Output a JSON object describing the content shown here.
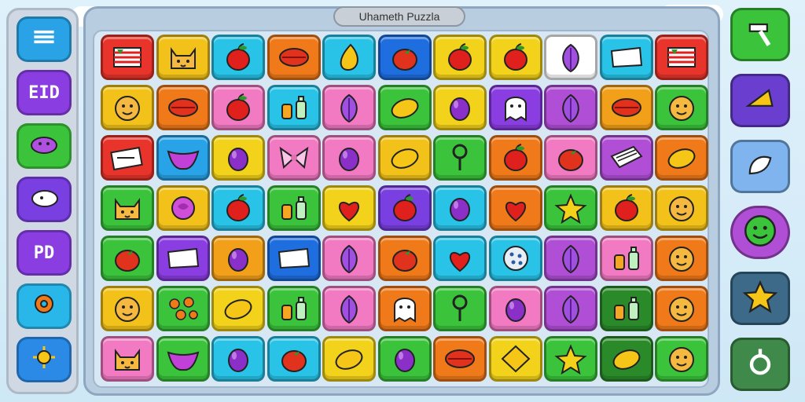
{
  "title": "Uhameth Puzzla",
  "left_panel": {
    "buttons": [
      {
        "id": "menu",
        "icon": "menu-icon",
        "label": "",
        "color": "#2aa3e6"
      },
      {
        "id": "eid",
        "icon": "",
        "label": "EID",
        "color": "#8a3de0"
      },
      {
        "id": "monster",
        "icon": "blob-monster-icon",
        "label": "",
        "color": "#3bc43b"
      },
      {
        "id": "cloud",
        "icon": "cloud-creature-icon",
        "label": "",
        "color": "#7a3fe0"
      },
      {
        "id": "pd",
        "icon": "",
        "label": "PD",
        "color": "#8a3de0"
      },
      {
        "id": "settings",
        "icon": "gear-icon",
        "label": "",
        "color": "#29b6e8"
      },
      {
        "id": "sun",
        "icon": "sun-icon",
        "label": "",
        "color": "#2a8ae6"
      }
    ]
  },
  "right_panel": {
    "buttons": [
      {
        "id": "tool",
        "icon": "hammer-tool-icon",
        "color": "#3bc43b"
      },
      {
        "id": "cheese",
        "icon": "cheese-icon",
        "color": "#6a3fd0"
      },
      {
        "id": "ghost",
        "icon": "ghost-icon",
        "color": "#7fb4ee"
      },
      {
        "id": "face",
        "icon": "smiley-face-icon",
        "color": "#b04fd6"
      },
      {
        "id": "star",
        "icon": "star-icon",
        "color": "#3d6a88"
      },
      {
        "id": "ring",
        "icon": "ring-icon",
        "color": "#3f8a4a"
      }
    ]
  },
  "board": {
    "rows": [
      [
        [
          "#e8342a",
          "flag"
        ],
        [
          "#f2c21a",
          "cat"
        ],
        [
          "#29c3e8",
          "apple"
        ],
        [
          "#f07a1a",
          "leaf"
        ],
        [
          "#29c3e8",
          "drop"
        ],
        [
          "#1e6ee0",
          "tomato"
        ],
        [
          "#f2d21a",
          "apple"
        ],
        [
          "#f2d21a",
          "apple"
        ],
        [
          "#ffffff",
          "feather"
        ],
        [
          "#29c3e8",
          "paper"
        ],
        [
          "#e8342a",
          "flag"
        ]
      ],
      [
        [
          "#f2c21a",
          "face"
        ],
        [
          "#f07a1a",
          "leaf"
        ],
        [
          "#f27ac2",
          "apple"
        ],
        [
          "#29c3e8",
          "bottle"
        ],
        [
          "#f27ac2",
          "feather"
        ],
        [
          "#3bc43b",
          "lemon"
        ],
        [
          "#f2d21a",
          "plum"
        ],
        [
          "#8a3de0",
          "ghost"
        ],
        [
          "#b04fd6",
          "feather"
        ],
        [
          "#f2a01a",
          "leaf"
        ],
        [
          "#3bc43b",
          "face"
        ]
      ],
      [
        [
          "#e8342a",
          "card"
        ],
        [
          "#29a3e8",
          "boat"
        ],
        [
          "#f2d21a",
          "plum"
        ],
        [
          "#f27ac2",
          "bow"
        ],
        [
          "#f27ac2",
          "plum"
        ],
        [
          "#f2c21a",
          "lemon"
        ],
        [
          "#3bc43b",
          "key"
        ],
        [
          "#f07a1a",
          "apple"
        ],
        [
          "#f27ac2",
          "tomato"
        ],
        [
          "#b04fd6",
          "book"
        ],
        [
          "#f07a1a",
          "lemon"
        ]
      ],
      [
        [
          "#3bc43b",
          "cat"
        ],
        [
          "#f2c21a",
          "rose"
        ],
        [
          "#29c3e8",
          "apple"
        ],
        [
          "#3bc43b",
          "bottle"
        ],
        [
          "#f2d21a",
          "heart"
        ],
        [
          "#7a3fe0",
          "apple"
        ],
        [
          "#29c3e8",
          "plum"
        ],
        [
          "#f07a1a",
          "heart"
        ],
        [
          "#3bc43b",
          "star"
        ],
        [
          "#f2c21a",
          "apple"
        ],
        [
          "#f2c21a",
          "face"
        ]
      ],
      [
        [
          "#3bc43b",
          "tomato"
        ],
        [
          "#8a3de0",
          "paper"
        ],
        [
          "#f2a01a",
          "plum"
        ],
        [
          "#1e6ee0",
          "paper"
        ],
        [
          "#f27ac2",
          "feather"
        ],
        [
          "#f07a1a",
          "tomato"
        ],
        [
          "#29c3e8",
          "heart"
        ],
        [
          "#29c3e8",
          "dots"
        ],
        [
          "#b04fd6",
          "feather"
        ],
        [
          "#f27ac2",
          "bottle"
        ],
        [
          "#f07a1a",
          "face"
        ]
      ],
      [
        [
          "#f2c21a",
          "face"
        ],
        [
          "#3bc43b",
          "flowers"
        ],
        [
          "#f2d21a",
          "lemon"
        ],
        [
          "#3bc43b",
          "bottle"
        ],
        [
          "#f27ac2",
          "feather"
        ],
        [
          "#f07a1a",
          "ghost"
        ],
        [
          "#3bc43b",
          "key"
        ],
        [
          "#f27ac2",
          "plum"
        ],
        [
          "#b04fd6",
          "feather"
        ],
        [
          "#2a8a2a",
          "bottle"
        ],
        [
          "#f07a1a",
          "face"
        ]
      ],
      [
        [
          "#f27ac2",
          "cat"
        ],
        [
          "#3bc43b",
          "boat"
        ],
        [
          "#29c3e8",
          "plum"
        ],
        [
          "#29c3e8",
          "tomato"
        ],
        [
          "#f2d21a",
          "lemon"
        ],
        [
          "#3bc43b",
          "plum"
        ],
        [
          "#f07a1a",
          "leaf"
        ],
        [
          "#f2d21a",
          "diamond"
        ],
        [
          "#3bc43b",
          "star"
        ],
        [
          "#2a8a2a",
          "lemon"
        ],
        [
          "#3bc43b",
          "face"
        ]
      ]
    ]
  }
}
